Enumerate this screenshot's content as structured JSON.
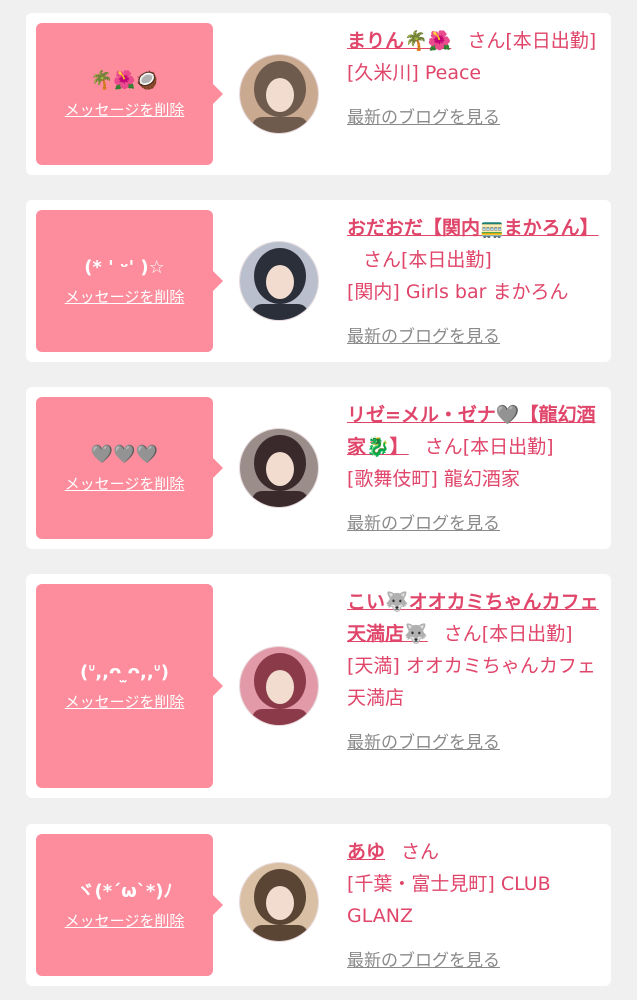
{
  "cards": [
    {
      "emote": "🌴🌺🥥",
      "delete_label": "メッセージを削除",
      "name": "まりん🌴🌺",
      "san": "さん",
      "status": "[本日出勤]",
      "shop": "[久米川] Peace",
      "blog_label": "最新のブログを見る",
      "avatar_colors": [
        "#c9a98f",
        "#6f5a4e"
      ]
    },
    {
      "emote": "(* ' ᵕ' )☆",
      "delete_label": "メッセージを削除",
      "name": "おだおだ【関内🚃まかろん】",
      "san": "さん",
      "status": "[本日出勤]",
      "shop": "[関内] Girls bar まかろん",
      "blog_label": "最新のブログを見る",
      "avatar_colors": [
        "#b9bfcc",
        "#2b2f3a"
      ]
    },
    {
      "emote": "🩶🩶🩶",
      "delete_label": "メッセージを削除",
      "name": "リゼ=メル・ゼナ🩶【龍幻酒家🐉】",
      "san": "さん",
      "status": "[本日出勤]",
      "shop": "[歌舞伎町] 龍幻酒家",
      "blog_label": "最新のブログを見る",
      "avatar_colors": [
        "#9a8d8a",
        "#3a2a2c"
      ]
    },
    {
      "emote": "(ᐡ,,ᴖ ̫ᴖ,,ᐡ)",
      "delete_label": "メッセージを削除",
      "name": "こい🐺オオカミちゃんカフェ天満店🐺",
      "san": "さん",
      "status": "[本日出勤]",
      "shop": "[天満] オオカミちゃんカフェ天満店",
      "blog_label": "最新のブログを見る",
      "avatar_colors": [
        "#e39aa8",
        "#8a3a48"
      ]
    },
    {
      "emote": "ヾ(*´ω`*)ﾉ",
      "delete_label": "メッセージを削除",
      "name": "あゆ",
      "san": "さん",
      "status": "",
      "shop": "[千葉・富士見町] CLUB GLANZ",
      "blog_label": "最新のブログを見る",
      "avatar_colors": [
        "#d9bfa3",
        "#5a4535"
      ]
    }
  ]
}
